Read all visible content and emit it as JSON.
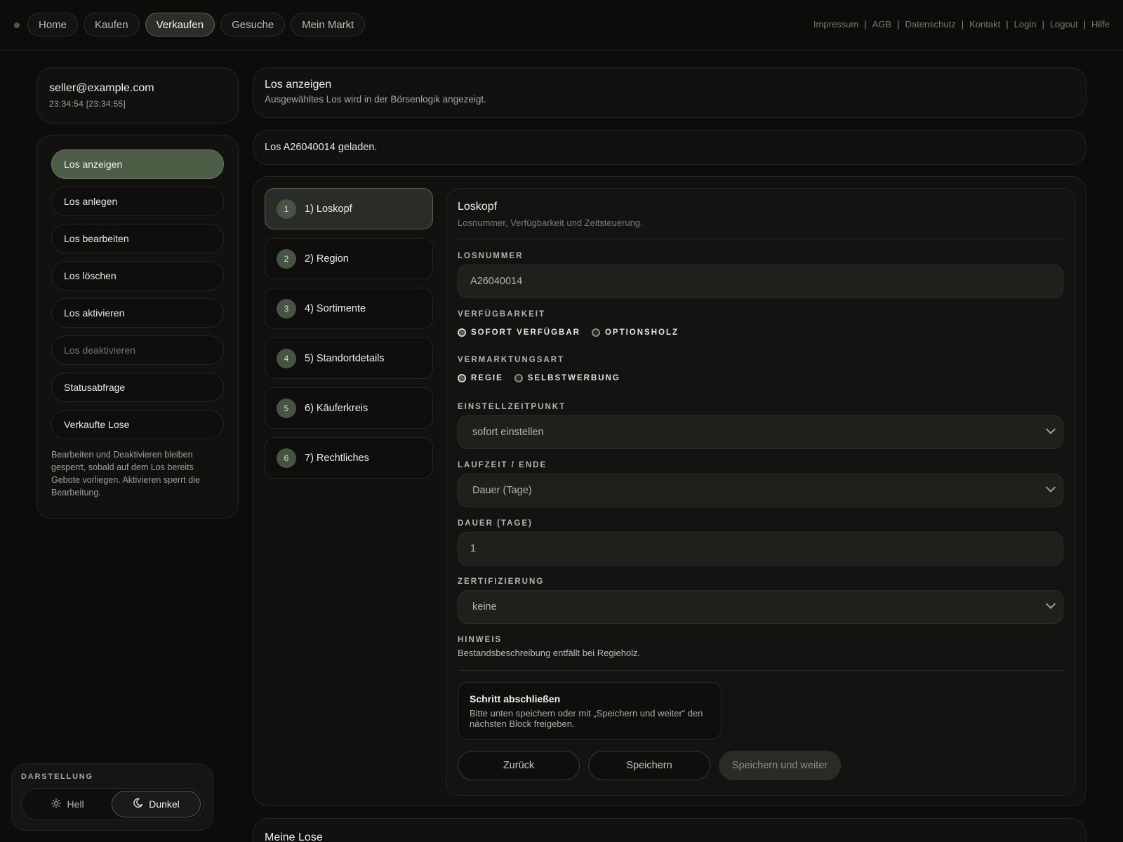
{
  "nav": {
    "items": [
      "Home",
      "Kaufen",
      "Verkaufen",
      "Gesuche",
      "Mein Markt"
    ],
    "active": "Verkaufen"
  },
  "toplinks": [
    "Impressum",
    "AGB",
    "Datenschutz",
    "Kontakt",
    "Login",
    "Logout",
    "Hilfe"
  ],
  "user": {
    "email": "seller@example.com",
    "time": "23:34:54 [23:34:55]"
  },
  "sidebar": {
    "items": [
      {
        "label": "Los anzeigen"
      },
      {
        "label": "Los anlegen"
      },
      {
        "label": "Los bearbeiten"
      },
      {
        "label": "Los löschen"
      },
      {
        "label": "Los aktivieren"
      },
      {
        "label": "Los deaktivieren"
      },
      {
        "label": "Statusabfrage"
      },
      {
        "label": "Verkaufte Lose"
      }
    ],
    "note": "Bearbeiten und Deaktivieren bleiben gesperrt, sobald auf dem Los bereits Gebote vorliegen. Aktivieren sperrt die Bearbeitung."
  },
  "theme": {
    "label": "DARSTELLUNG",
    "light": "Hell",
    "dark": "Dunkel"
  },
  "header": {
    "title": "Los anzeigen",
    "subtitle": "Ausgewähltes Los wird in der Börsenlogik angezeigt."
  },
  "message": "Los A26040014 geladen.",
  "steps": [
    {
      "num": "1",
      "label": "1) Loskopf"
    },
    {
      "num": "2",
      "label": "2) Region"
    },
    {
      "num": "3",
      "label": "4) Sortimente"
    },
    {
      "num": "4",
      "label": "5) Standortdetails"
    },
    {
      "num": "5",
      "label": "6) Käuferkreis"
    },
    {
      "num": "6",
      "label": "7) Rechtliches"
    }
  ],
  "form": {
    "title": "Loskopf",
    "subtitle": "Losnummer, Verfügbarkeit und Zeitsteuerung.",
    "losnummer_label": "LOSNUMMER",
    "losnummer_value": "A26040014",
    "verfuegbarkeit_label": "VERFÜGBARKEIT",
    "verfuegbarkeit_opt1": "SOFORT VERFÜGBAR",
    "verfuegbarkeit_opt2": "OPTIONSHOLZ",
    "vermarktung_label": "VERMARKTUNGSART",
    "vermarktung_opt1": "REGIE",
    "vermarktung_opt2": "SELBSTWERBUNG",
    "einstell_label": "EINSTELLZEITPUNKT",
    "einstell_value": "sofort einstellen",
    "laufzeit_label": "LAUFZEIT / ENDE",
    "laufzeit_value": "Dauer (Tage)",
    "dauer_label": "DAUER (TAGE)",
    "dauer_value": "1",
    "zert_label": "ZERTIFIZIERUNG",
    "zert_value": "keine",
    "hinweis_label": "HINWEIS",
    "hinweis_text": "Bestandsbeschreibung entfällt bei Regieholz.",
    "done_title": "Schritt abschließen",
    "done_text": "Bitte unten speichern oder mit „Speichern und weiter“ den nächsten Block freigeben.",
    "btn_back": "Zurück",
    "btn_save": "Speichern",
    "btn_save_next": "Speichern und weiter"
  },
  "bottom": {
    "title": "Meine Lose"
  },
  "colors": {
    "accent": "#4b5d45",
    "background": "#0d0c0b",
    "link": "#6f7f6a"
  }
}
